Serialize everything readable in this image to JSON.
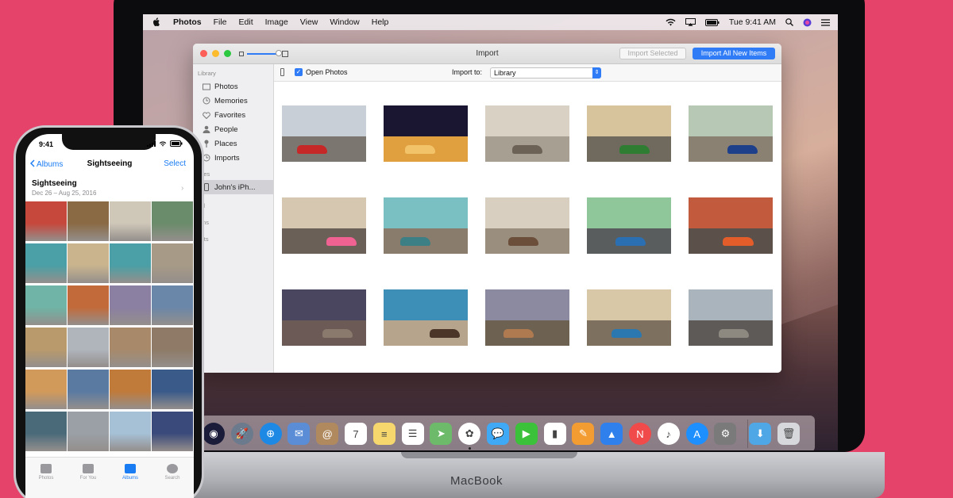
{
  "menubar": {
    "app_name": "Photos",
    "menus": [
      "File",
      "Edit",
      "Image",
      "View",
      "Window",
      "Help"
    ],
    "clock": "Tue 9:41 AM"
  },
  "window": {
    "title": "Import",
    "import_selected_label": "Import Selected",
    "import_all_label": "Import All New Items",
    "open_photos_label": "Open Photos",
    "open_photos_checked": true,
    "import_to_label": "Import to:",
    "import_to_value": "Library"
  },
  "sidebar": {
    "library_header": "Library",
    "library_items": [
      {
        "label": "Photos",
        "icon": "photos-icon"
      },
      {
        "label": "Memories",
        "icon": "memories-icon"
      },
      {
        "label": "Favorites",
        "icon": "heart-icon"
      },
      {
        "label": "People",
        "icon": "person-icon"
      },
      {
        "label": "Places",
        "icon": "pin-icon"
      },
      {
        "label": "Imports",
        "icon": "clock-icon"
      }
    ],
    "devices_header": "evices",
    "device_item": "John's iPh...",
    "shared_header": "ared",
    "albums_header": "lbums",
    "projects_header": "ojects"
  },
  "import_grid": {
    "photos": [
      {
        "sky": "#c9cfd6",
        "ground": "#7b7670",
        "car": "#c62828"
      },
      {
        "sky": "#1a1530",
        "ground": "#e0a040",
        "car": "#f3c36a"
      },
      {
        "sky": "#d9d2c4",
        "ground": "#a89f93",
        "car": "#6d6256"
      },
      {
        "sky": "#d8c49c",
        "ground": "#6f6a5d",
        "car": "#2e7d32"
      },
      {
        "sky": "#b7c9b5",
        "ground": "#8a8173",
        "car": "#1e3f8a"
      },
      {
        "sky": "#d6c8b0",
        "ground": "#6a6058",
        "car": "#f06292"
      },
      {
        "sky": "#7ac0c2",
        "ground": "#897c6c",
        "car": "#3c7f84"
      },
      {
        "sky": "#d9cfc0",
        "ground": "#9a8e7e",
        "car": "#6b4f3a"
      },
      {
        "sky": "#8fc79a",
        "ground": "#595d5d",
        "car": "#2b6fb3"
      },
      {
        "sky": "#c25b3d",
        "ground": "#5b504a",
        "car": "#e35d2b"
      },
      {
        "sky": "#4b4660",
        "ground": "#6b5a55",
        "car": "#8a7a6e"
      },
      {
        "sky": "#3d8fb8",
        "ground": "#b6a48c",
        "car": "#4a3528"
      },
      {
        "sky": "#8b8aa0",
        "ground": "#6d6152",
        "car": "#b07a50"
      },
      {
        "sky": "#d8c8a8",
        "ground": "#7d705e",
        "car": "#2b78b0"
      },
      {
        "sky": "#aab4bd",
        "ground": "#5d5a57",
        "car": "#8d8880"
      }
    ]
  },
  "dock": {
    "icons": [
      {
        "name": "siri-icon",
        "color": "#1b1b3a",
        "glyph": "◉"
      },
      {
        "name": "launchpad-icon",
        "color": "#6b7a8c",
        "glyph": "🚀"
      },
      {
        "name": "safari-icon",
        "color": "#1e88e5",
        "glyph": "⊕"
      },
      {
        "name": "mail-icon",
        "color": "#5b8dd6",
        "glyph": "✉"
      },
      {
        "name": "contacts-icon",
        "color": "#b08a5e",
        "glyph": "@"
      },
      {
        "name": "calendar-icon",
        "color": "#ffffff",
        "glyph": "7"
      },
      {
        "name": "notes-icon",
        "color": "#f5d76e",
        "glyph": "≡"
      },
      {
        "name": "reminders-icon",
        "color": "#ffffff",
        "glyph": "☰"
      },
      {
        "name": "maps-icon",
        "color": "#6dbb6a",
        "glyph": "➤"
      },
      {
        "name": "photos-app-icon",
        "color": "#ffffff",
        "glyph": "✿"
      },
      {
        "name": "messages-icon",
        "color": "#3fa9f5",
        "glyph": "💬"
      },
      {
        "name": "facetime-icon",
        "color": "#3cc13b",
        "glyph": "▶"
      },
      {
        "name": "numbers-icon",
        "color": "#ffffff",
        "glyph": "▮"
      },
      {
        "name": "pages-icon",
        "color": "#f39c32",
        "glyph": "✎"
      },
      {
        "name": "keynote-icon",
        "color": "#2f80ed",
        "glyph": "▲"
      },
      {
        "name": "news-icon",
        "color": "#f04a4a",
        "glyph": "N"
      },
      {
        "name": "music-icon",
        "color": "#ffffff",
        "glyph": "♪"
      },
      {
        "name": "app-store-icon",
        "color": "#1e8fff",
        "glyph": "A"
      },
      {
        "name": "system-preferences-icon",
        "color": "#7a7a7a",
        "glyph": "⚙"
      },
      {
        "name": "downloads-folder-icon",
        "color": "#4fa7e6",
        "glyph": "⬇"
      },
      {
        "name": "trash-icon",
        "color": "#d6d8dc",
        "glyph": "🗑"
      }
    ]
  },
  "macbook_label": "MacBook",
  "iphone": {
    "time": "9:41",
    "back_label": "Albums",
    "nav_title": "Sightseeing",
    "select_label": "Select",
    "album_title": "Sightseeing",
    "album_dates": "Dec 26 – Aug 25, 2016",
    "grid_colors": [
      "#c6473c",
      "#8a6a44",
      "#cfc7b8",
      "#6a8c6a",
      "#4aa0a6",
      "#c9b48e",
      "#4aa0a6",
      "#a79a86",
      "#6fb4a6",
      "#c26a3a",
      "#8b7fa2",
      "#6a86a8",
      "#b99a6c",
      "#b0b5bc",
      "#a88a6a",
      "#8e7a66",
      "#d29a5a",
      "#5a7aa2",
      "#c07a3a",
      "#3a5a8a",
      "#4a6a7a",
      "#9aa0a6",
      "#a6c0d6",
      "#3a4a7a"
    ],
    "tabs": [
      {
        "label": "Photos",
        "active": false
      },
      {
        "label": "For You",
        "active": false
      },
      {
        "label": "Albums",
        "active": true
      },
      {
        "label": "Search",
        "active": false
      }
    ]
  }
}
